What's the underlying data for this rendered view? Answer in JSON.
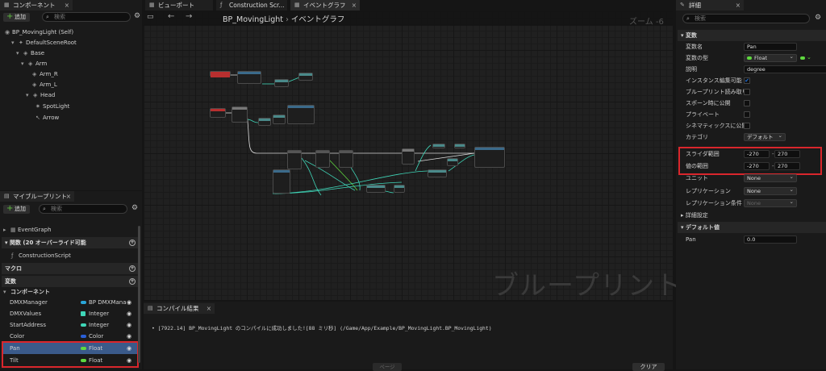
{
  "left_panel": {
    "components_tab": "コンポーネント",
    "add_label": "追加",
    "search_placeholder": "検索",
    "tree": [
      {
        "label": "BP_MovingLight (Self)",
        "icon": "blueprint-self-icon"
      },
      {
        "label": "DefaultSceneRoot",
        "icon": "scene-root-icon"
      },
      {
        "label": "Base",
        "icon": "mesh-icon"
      },
      {
        "label": "Arm",
        "icon": "mesh-icon"
      },
      {
        "label": "Arm_R",
        "icon": "mesh-icon"
      },
      {
        "label": "Arm_L",
        "icon": "mesh-icon"
      },
      {
        "label": "Head",
        "icon": "mesh-icon"
      },
      {
        "label": "SpotLight",
        "icon": "spotlight-icon"
      },
      {
        "label": "Arrow",
        "icon": "arrow-icon"
      }
    ]
  },
  "my_blueprint": {
    "tab": "マイブループリント",
    "add_label": "追加",
    "search_placeholder": "検索",
    "event_graph": "EventGraph",
    "functions_section": "関数 (20 オーバーライド可能",
    "construction_script": "ConstructionScript",
    "macros_section": "マクロ",
    "variables_section": "変数",
    "components_sub": "コンポーネント",
    "variables": [
      {
        "name": "DMXManager",
        "type": "BP DMXManager",
        "color": "#2aa6d8"
      },
      {
        "name": "DMXValues",
        "type": "Integer",
        "color": "#3fd6b8"
      },
      {
        "name": "StartAddress",
        "type": "Integer",
        "color": "#3fd6b8"
      },
      {
        "name": "Color",
        "type": "Color",
        "color": "#2a5fd8"
      },
      {
        "name": "Pan",
        "type": "Float",
        "color": "#5fd83f"
      },
      {
        "name": "Tilt",
        "type": "Float",
        "color": "#5fd83f"
      }
    ]
  },
  "tabs": {
    "viewport": "ビューポート",
    "construction_script": "Construction Scr...",
    "event_graph": "イベントグラフ",
    "details": "詳細"
  },
  "graph": {
    "breadcrumb_bp": "BP_MovingLight",
    "breadcrumb_sep": "›",
    "breadcrumb_graph": "イベントグラフ",
    "zoom": "ズーム -6",
    "watermark": "ブループリント"
  },
  "compiler": {
    "tab": "コンパイル結果",
    "message": "[7922.14] BP_MovingLight のコンパイルに成功しました![88 ミリ秒] (/Game/App/Example/BP_MovingLight.BP_MovingLight)",
    "page_button": "ページ",
    "clear_button": "クリア"
  },
  "details": {
    "search_placeholder": "検索",
    "variable_section": "変数",
    "rows": {
      "var_name_label": "変数名",
      "var_name_value": "Pan",
      "var_type_label": "変数の型",
      "var_type_value": "Float",
      "description_label": "説明",
      "description_value": "degree",
      "instance_editable_label": "インスタンス編集可能",
      "blueprint_readonly_label": "ブループリント読み取り",
      "expose_spawn_label": "スポーン時に公開",
      "private_label": "プライベート",
      "expose_cinematics_label": "シネマティックスに公開",
      "category_label": "カテゴリ",
      "category_value": "デフォルト",
      "slider_range_label": "スライダ範囲",
      "slider_min": "-270",
      "slider_max": "270",
      "value_range_label": "値の範囲",
      "value_min": "-270",
      "value_max": "270",
      "range_dash": "-",
      "units_label": "ユニット",
      "units_value": "None",
      "replication_label": "レプリケーション",
      "replication_value": "None",
      "replication_cond_label": "レプリケーション条件",
      "replication_cond_value": "None"
    },
    "advanced_section": "詳細設定",
    "default_section": "デフォルト値",
    "default_pan_label": "Pan",
    "default_pan_value": "0.0"
  },
  "colors": {
    "highlight": "#d9262c",
    "selected_row": "#3a5a8a",
    "float_pin": "#5fd83f",
    "check_blue": "#1e6fd9"
  }
}
